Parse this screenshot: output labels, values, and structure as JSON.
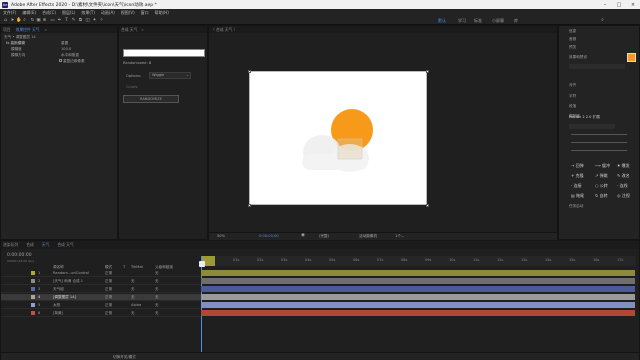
{
  "window": {
    "title": "Adobe After Effects 2020 - D:\\素材\\文件夹\\icon\\天气\\icon动效.aep *",
    "logo": "Ae"
  },
  "menu": [
    "文件(F)",
    "编辑(E)",
    "合成(C)",
    "图层(L)",
    "效果(T)",
    "动画(A)",
    "视图(V)",
    "窗口",
    "帮助(H)"
  ],
  "workspaces": [
    "默认",
    "学习",
    "标准",
    "小屏幕",
    "库"
  ],
  "effects_panel": {
    "tabs": [
      "项目",
      "效果控件 天气",
      "»"
    ],
    "header": "天气 • 调整图层 14",
    "rows": [
      "fx 高斯模糊",
      "模糊度",
      "模糊方向",
      "重复边缘像素"
    ],
    "values": [
      "重置",
      "100.0",
      "水平和垂直",
      "重复边缘像素"
    ]
  },
  "preview_panel": {
    "tabs": [
      "合成 天气",
      "»"
    ],
    "title": "〈 合成 天气 〉",
    "field_value": "",
    "randomseed_label": "Randomseed:",
    "randomseed_value": "0",
    "options_label": "Options:",
    "options_value": "Wiggle",
    "colors_label": "Colors:",
    "button": "RANDOMIZE"
  },
  "viewer": {
    "zoom": "50%",
    "timecode": "0:00:00:00",
    "quality": "(完整)",
    "camera": "活动摄像机",
    "views": "1个..."
  },
  "right_panel": {
    "sections": [
      "信息",
      "音频",
      "预览",
      "效果和预设",
      "对齐",
      "字符",
      "段落",
      "跟踪器",
      "Motion 2 2.0 扩展"
    ],
    "motion_buttons": [
      "回弹",
      "缓冲",
      "爆发",
      "克隆",
      "弹跳",
      "改名",
      "连接",
      "公转",
      "连线",
      "拖尾",
      "自转",
      "注视"
    ],
    "bottom": "任务启动"
  },
  "timeline": {
    "tabs": [
      "渲染队列",
      "合成",
      "天气",
      "合成 天气"
    ],
    "timecode": "0:00:00:00",
    "frame_info": "00000 (25.00 fps)",
    "columns": [
      "源名称",
      "模式",
      "T",
      "TrkMat",
      "父级和链接"
    ],
    "layers": [
      {
        "num": "1",
        "name": "Random...orlControl",
        "mode": "正常",
        "trk": "",
        "parent": "无",
        "color": "#b5a53c"
      },
      {
        "num": "2",
        "name": "[天气] 雨滴 合成 1",
        "mode": "正常",
        "trk": "无",
        "parent": "无",
        "color": "#8c8c8c"
      },
      {
        "num": "3",
        "name": "天气组",
        "mode": "正常",
        "trk": "无",
        "parent": "无",
        "color": "#5a6aa8"
      },
      {
        "num": "4",
        "name": "[调整图层 14]",
        "mode": "正常",
        "trk": "无",
        "parent": "无",
        "color": "#a6a6a6"
      },
      {
        "num": "5",
        "name": "太阳",
        "mode": "正常",
        "trk": "Alpha",
        "parent": "无",
        "color": "#8f9fd0"
      },
      {
        "num": "6",
        "name": "[背景]",
        "mode": "正常",
        "trk": "无",
        "parent": "无",
        "color": "#c8503f"
      }
    ],
    "ruler": [
      "00s",
      "01s",
      "02s",
      "03s",
      "04s",
      "05s",
      "06s",
      "07s",
      "08s",
      "09s",
      "10s",
      "11s",
      "12s",
      "13s",
      "14s",
      "15s",
      "16s",
      "17s",
      "18s"
    ],
    "footer": "切换开关/模式"
  },
  "colors": {
    "sun": "#f79a19",
    "accent_blue": "#4f8be6",
    "swatch_orange": "#f39a2a"
  }
}
